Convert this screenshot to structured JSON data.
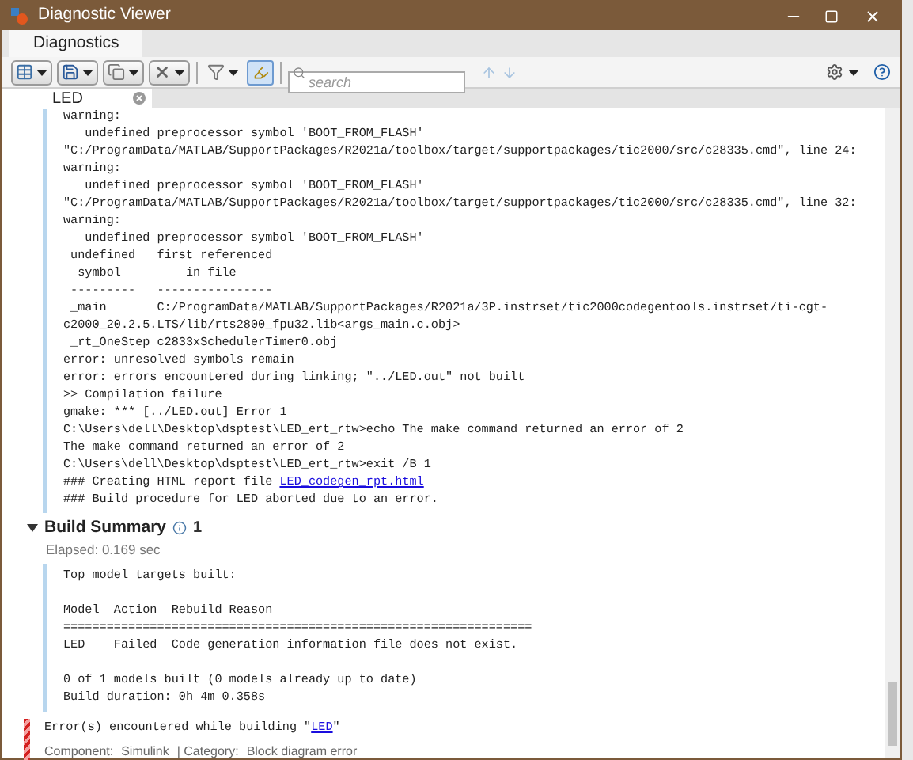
{
  "window": {
    "title": "Diagnostic Viewer"
  },
  "tabs": [
    {
      "label": "Diagnostics",
      "selected": true
    }
  ],
  "toolbar": {
    "highlight_on": true,
    "search": {
      "placeholder": "search"
    },
    "nav_disabled": true
  },
  "doc_tab": {
    "label": "LED"
  },
  "log": [
    {
      "text": "warning:"
    },
    {
      "text": "   undefined preprocessor symbol 'BOOT_FROM_FLASH'"
    },
    {
      "text": "\"C:/ProgramData/MATLAB/SupportPackages/R2021a/toolbox/target/supportpackages/tic2000/src/c28335.cmd\", line 24:"
    },
    {
      "text": "warning:"
    },
    {
      "text": "   undefined preprocessor symbol 'BOOT_FROM_FLASH'"
    },
    {
      "text": "\"C:/ProgramData/MATLAB/SupportPackages/R2021a/toolbox/target/supportpackages/tic2000/src/c28335.cmd\", line 32:"
    },
    {
      "text": "warning:"
    },
    {
      "text": "   undefined preprocessor symbol 'BOOT_FROM_FLASH'"
    },
    {
      "text": " undefined   first referenced"
    },
    {
      "text": "  symbol         in file"
    },
    {
      "text": " ---------   ----------------"
    },
    {
      "text": " _main       C:/ProgramData/MATLAB/SupportPackages/R2021a/3P.instrset/tic2000codegentools.instrset/ti-cgt-"
    },
    {
      "text": "c2000_20.2.5.LTS/lib/rts2800_fpu32.lib<args_main.c.obj>"
    },
    {
      "text": " _rt_OneStep c2833xSchedulerTimer0.obj"
    },
    {
      "text": "error: unresolved symbols remain"
    },
    {
      "text": "error: errors encountered during linking; \"../LED.out\" not built"
    },
    {
      "text": ">> Compilation failure"
    },
    {
      "text": "gmake: *** [../LED.out] Error 1"
    },
    {
      "text": "C:\\Users\\dell\\Desktop\\dsptest\\LED_ert_rtw>echo The make command returned an error of 2"
    },
    {
      "text": "The make command returned an error of 2"
    },
    {
      "text": "C:\\Users\\dell\\Desktop\\dsptest\\LED_ert_rtw>exit /B 1"
    },
    {
      "text": "### Creating HTML report file ",
      "link": "LED_codegen_rpt.html"
    },
    {
      "text": "### Build procedure for LED aborted due to an error."
    }
  ],
  "build_summary": {
    "title": "Build Summary",
    "expanded": true,
    "info_count": "1",
    "elapsed": "Elapsed: 0.169 sec",
    "blocks": [
      [
        "Top model targets built:"
      ],
      [
        "Model  Action  Rebuild Reason",
        "=================================================================",
        "LED    Failed  Code generation information file does not exist."
      ],
      [
        "0 of 1 models built (0 models already up to date)",
        "Build duration: 0h 4m 0.358s"
      ]
    ]
  },
  "error": {
    "prefix": "Error(s) encountered while building \"",
    "link": "LED",
    "suffix": "\"",
    "details": [
      {
        "label": "Component:",
        "value": "Simulink"
      },
      {
        "label": "| Category:",
        "value": "Block diagram error"
      }
    ]
  }
}
